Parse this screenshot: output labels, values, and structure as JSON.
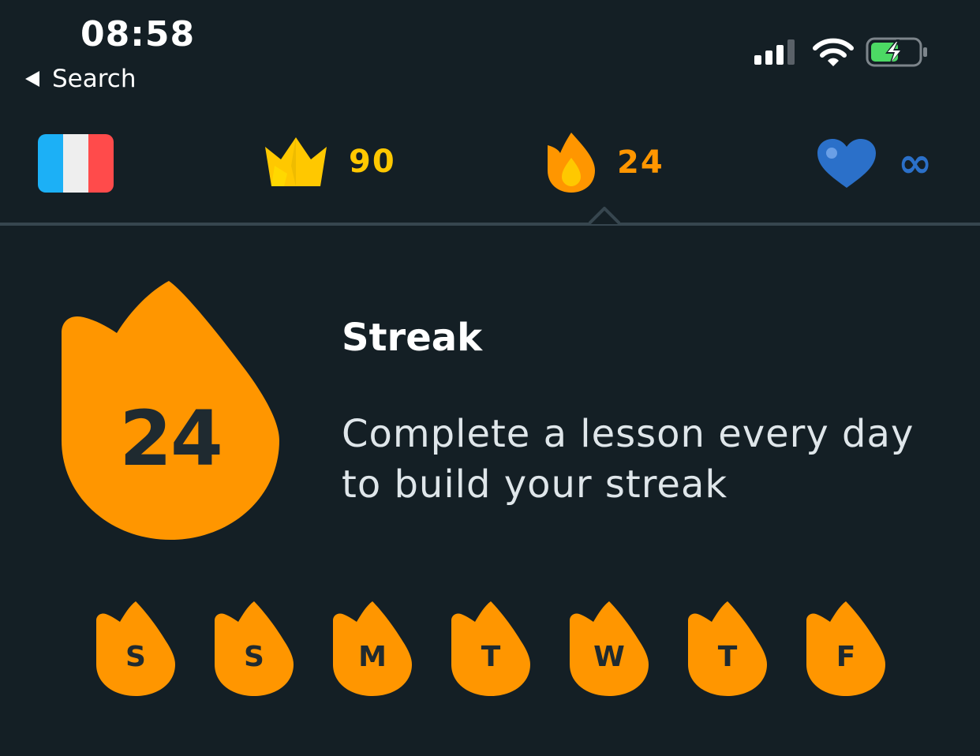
{
  "status_bar": {
    "time": "08:58",
    "back_label": "Search"
  },
  "top_bar": {
    "language_flag": "france-flag-icon",
    "crowns": {
      "icon": "crown-icon",
      "value": "90"
    },
    "streak": {
      "icon": "flame-icon",
      "value": "24"
    },
    "hearts": {
      "icon": "heart-icon",
      "value": "∞"
    }
  },
  "streak_panel": {
    "count": "24",
    "title": "Streak",
    "description": "Complete a lesson every day to build your streak",
    "days": [
      {
        "letter": "S"
      },
      {
        "letter": "S"
      },
      {
        "letter": "M"
      },
      {
        "letter": "T"
      },
      {
        "letter": "W"
      },
      {
        "letter": "T"
      },
      {
        "letter": "F"
      }
    ]
  },
  "colors": {
    "background": "#141f25",
    "streak_orange": "#ff9600",
    "crown_gold": "#ffc800",
    "heart_blue": "#2b70c9",
    "divider": "#37464f"
  }
}
